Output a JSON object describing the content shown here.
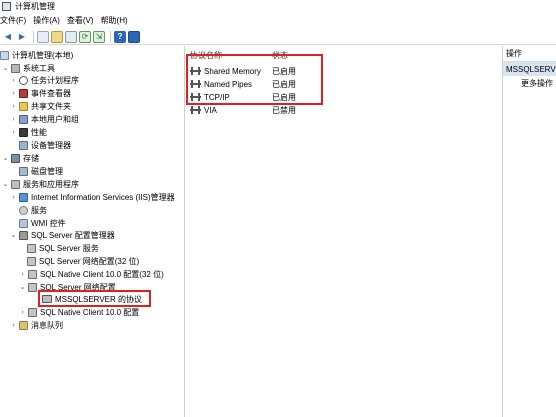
{
  "window": {
    "title": "计算机管理"
  },
  "menu": [
    "文件(F)",
    "操作(A)",
    "查看(V)",
    "帮助(H)"
  ],
  "toolbar": [
    {
      "icon": "back-arrow-icon",
      "glyph": "←",
      "color": "#2f6fb3"
    },
    {
      "icon": "forward-arrow-icon",
      "glyph": "→",
      "color": "#2f6fb3"
    },
    {
      "icon": "show-hide-tree-icon",
      "glyph": "▤",
      "color": "#6b8fb7"
    },
    {
      "icon": "folder-up-icon",
      "glyph": "▥",
      "color": "#c8a13b"
    },
    {
      "icon": "properties-icon",
      "glyph": "▦",
      "color": "#5b7fa8"
    },
    {
      "icon": "refresh-icon",
      "glyph": "⟳",
      "color": "#3b8a3b"
    },
    {
      "icon": "export-list-icon",
      "glyph": "⇲",
      "color": "#3b8a3b"
    },
    {
      "icon": "help-icon",
      "glyph": "?",
      "color": "#1f5fb0"
    },
    {
      "icon": "mmc-view-icon",
      "glyph": "▣",
      "color": "#1f5fb0"
    }
  ],
  "tree": {
    "root": "计算机管理(本地)",
    "system_tools": "系统工具",
    "task_scheduler": "任务计划程序",
    "event_viewer": "事件查看器",
    "shared_folders": "共享文件夹",
    "local_users": "本地用户和组",
    "performance": "性能",
    "device_manager": "设备管理器",
    "storage": "存储",
    "disk_management": "磁盘管理",
    "services_apps": "服务和应用程序",
    "iis_manager": "Internet Information Services (IIS)管理器",
    "services": "服务",
    "wmi_control": "WMI 控件",
    "sql_config_manager": "SQL Server 配置管理器",
    "sql_services": "SQL Server 服务",
    "sql_network_32": "SQL Server 网络配置(32 位)",
    "native_client_32": "SQL Native Client 10.0 配置(32 位)",
    "sql_network": "SQL Server 网络配置",
    "mssqlserver_protocols": "MSSQLSERVER 的协议",
    "native_client": "SQL Native Client 10.0 配置",
    "message_queuing": "消息队列"
  },
  "list": {
    "columns": [
      "协议名称",
      "状态"
    ],
    "rows": [
      {
        "name": "Shared Memory",
        "status": "已启用"
      },
      {
        "name": "Named Pipes",
        "status": "已启用"
      },
      {
        "name": "TCP/IP",
        "status": "已启用"
      },
      {
        "name": "VIA",
        "status": "已禁用"
      }
    ]
  },
  "actions": {
    "header": "操作",
    "section": "MSSQLSERVER",
    "more": "更多操作"
  },
  "colors": {
    "highlight": "#e02020",
    "selection": "#d7e4f2"
  }
}
